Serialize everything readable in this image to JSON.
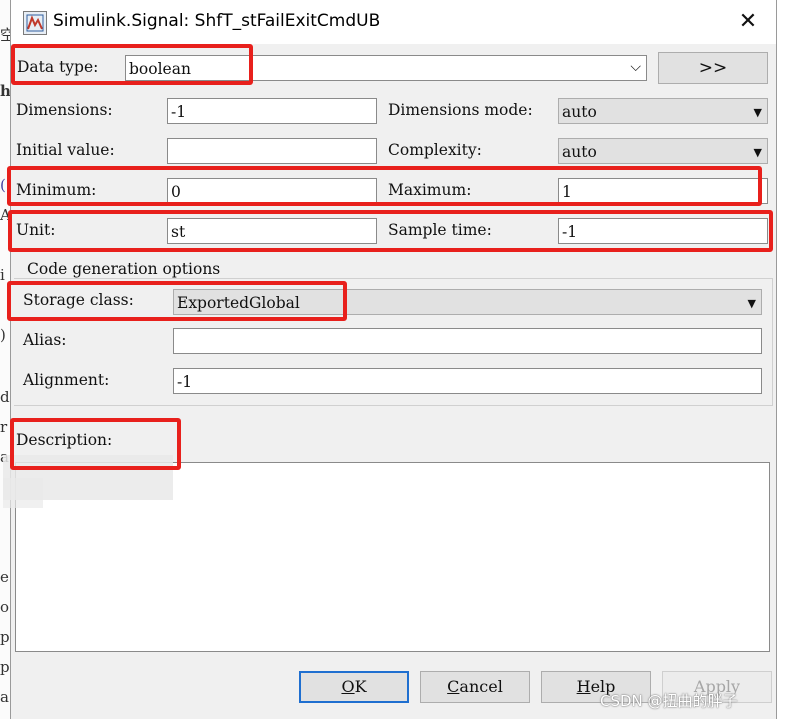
{
  "background": {
    "glyphs": [
      "空",
      "h",
      "(",
      "A",
      "i",
      ")",
      "d",
      "r",
      "a",
      "e",
      "o",
      "p",
      "p",
      "a"
    ]
  },
  "dialog": {
    "title": "Simulink.Signal: ShfT_stFailExitCmdUB",
    "close_glyph": "✕",
    "data_type": {
      "label": "Data type:",
      "value": "boolean",
      "dropdown_glyph": "⌵"
    },
    "expand_button": ">>",
    "dimensions": {
      "label": "Dimensions:",
      "value": "-1"
    },
    "dimensions_mode": {
      "label": "Dimensions mode:",
      "value": "auto"
    },
    "initial_value": {
      "label": "Initial value:",
      "value": ""
    },
    "complexity": {
      "label": "Complexity:",
      "value": "auto"
    },
    "minimum": {
      "label": "Minimum:",
      "value": "0"
    },
    "maximum": {
      "label": "Maximum:",
      "value": "1"
    },
    "unit": {
      "label": "Unit:",
      "value": "st"
    },
    "sample_time": {
      "label": "Sample time:",
      "value": "-1"
    },
    "code_gen": {
      "title": "Code generation options",
      "storage_class": {
        "label": "Storage class:",
        "value": "ExportedGlobal"
      },
      "alias": {
        "label": "Alias:",
        "value": ""
      },
      "alignment": {
        "label": "Alignment:",
        "value": "-1"
      }
    },
    "description": {
      "label": "Description:",
      "value": ""
    },
    "buttons": {
      "ok": {
        "label": "OK",
        "mnemonic": "O",
        "rest": "K"
      },
      "cancel": {
        "label": "Cancel",
        "mnemonic": "C",
        "rest": "ancel"
      },
      "help": {
        "label": "Help",
        "mnemonic": "H",
        "rest": "elp"
      },
      "apply": {
        "label": "Apply"
      }
    }
  },
  "watermark": "CSDN @扭曲的胖子",
  "colors": {
    "highlight_red": "#e8201c",
    "ok_focus_blue": "#1f6fd0"
  }
}
